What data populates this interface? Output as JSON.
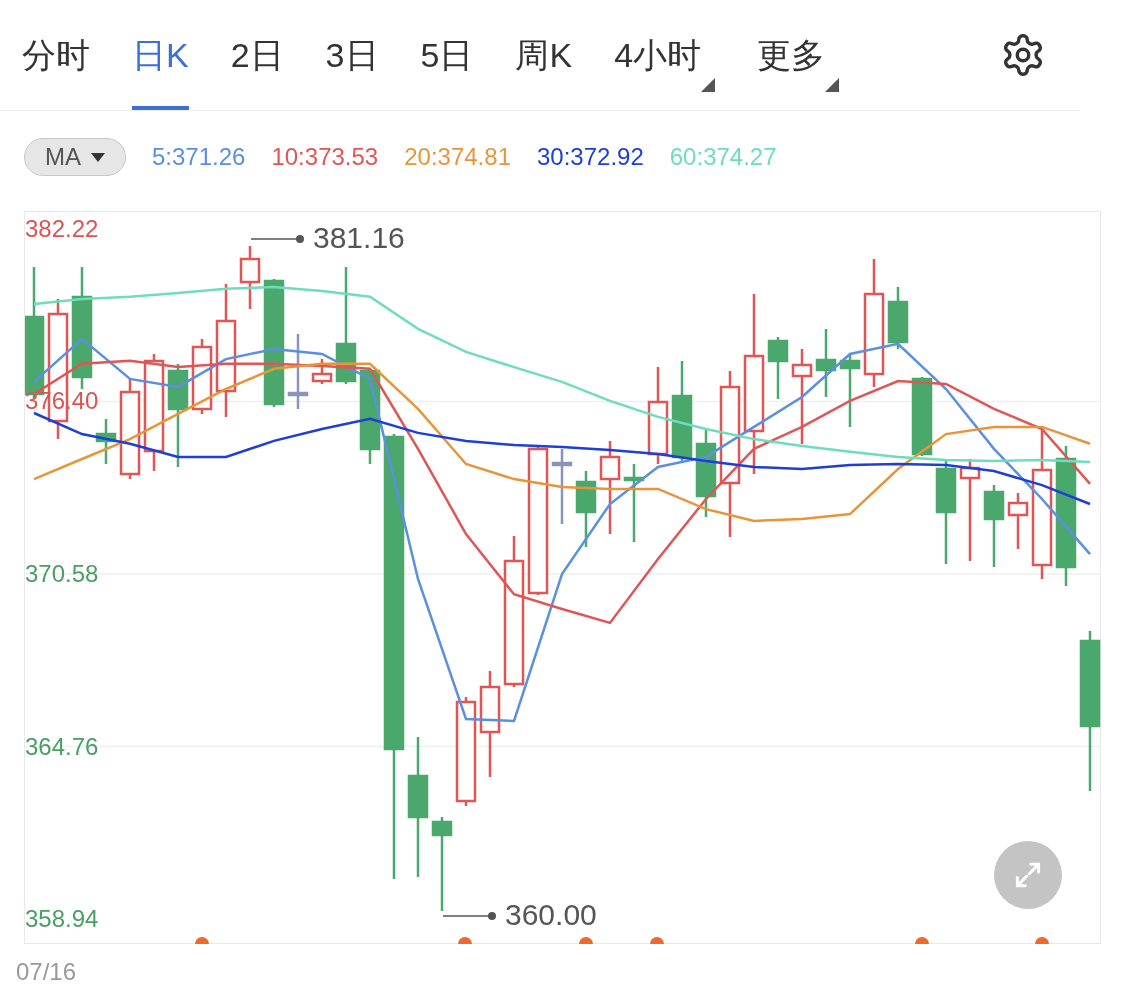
{
  "tabs": [
    {
      "label": "分时",
      "selected": false,
      "kind": "plain"
    },
    {
      "label": "日K",
      "selected": true,
      "kind": "plain"
    },
    {
      "label": "2日",
      "selected": false,
      "kind": "plain"
    },
    {
      "label": "3日",
      "selected": false,
      "kind": "plain"
    },
    {
      "label": "5日",
      "selected": false,
      "kind": "plain"
    },
    {
      "label": "周K",
      "selected": false,
      "kind": "plain"
    },
    {
      "label": "4小时",
      "selected": false,
      "kind": "menu"
    },
    {
      "label": "更多",
      "selected": false,
      "kind": "menu"
    }
  ],
  "indicator": {
    "selector": "MA"
  },
  "chart": {
    "chart_data": {
      "type": "line",
      "grid": true,
      "ylim": [
        358.1,
        382.79
      ],
      "yticks": [
        {
          "value": 382.22,
          "label": "382.22"
        },
        {
          "value": 376.4,
          "label": "376.40"
        },
        {
          "value": 370.58,
          "label": "370.58"
        },
        {
          "value": 364.76,
          "label": "364.76"
        },
        {
          "value": 358.94,
          "label": "358.94"
        }
      ],
      "series": [
        {
          "name": "5:371.26",
          "color": "#5b8fe0",
          "values": [
            377.06,
            378.51,
            377.16,
            376.89,
            377.83,
            378.17,
            378.0,
            377.16,
            370.41,
            365.69,
            365.62,
            370.58,
            372.94,
            374.19,
            374.53,
            375.54,
            376.55,
            378.0,
            378.34,
            376.82,
            374.8,
            373.11,
            371.25
          ]
        },
        {
          "name": "10:373.53",
          "color": "#e05555",
          "values": [
            376.65,
            377.67,
            377.77,
            377.56,
            377.67,
            377.67,
            377.6,
            377.5,
            374.8,
            371.93,
            369.9,
            369.4,
            368.93,
            371.09,
            373.11,
            374.8,
            375.54,
            376.42,
            377.09,
            376.99,
            376.15,
            375.47,
            373.62
          ]
        },
        {
          "name": "20:374.81",
          "color": "#e8953a",
          "values": [
            373.78,
            374.46,
            375.13,
            375.98,
            376.82,
            377.5,
            377.67,
            377.67,
            376.15,
            374.29,
            373.78,
            373.51,
            373.45,
            373.45,
            372.77,
            372.37,
            372.44,
            372.6,
            374.12,
            375.3,
            375.54,
            375.54,
            374.97
          ]
        },
        {
          "name": "30:372.92",
          "color": "#1d3fd6",
          "values": [
            376.01,
            375.3,
            374.97,
            374.53,
            374.53,
            375.07,
            375.47,
            375.81,
            375.34,
            375.07,
            374.93,
            374.86,
            374.76,
            374.63,
            374.39,
            374.19,
            374.12,
            374.26,
            374.29,
            374.26,
            374.05,
            373.58,
            372.94
          ]
        },
        {
          "name": "60:374.27",
          "color": "#6fdcbd",
          "values": [
            379.69,
            379.86,
            379.93,
            380.06,
            380.2,
            380.26,
            380.13,
            379.93,
            378.85,
            378.07,
            377.56,
            377.06,
            376.42,
            375.88,
            375.47,
            375.13,
            374.9,
            374.7,
            374.53,
            374.43,
            374.39,
            374.43,
            374.36
          ]
        }
      ]
    },
    "axis_labels": [
      {
        "color": "#d95454"
      },
      {
        "color": "#d95454"
      },
      {
        "color": "#4a9e64"
      },
      {
        "color": "#4a9e64"
      },
      {
        "color": "#4a9e64"
      }
    ],
    "max_label": "381.16",
    "min_label": "360.00",
    "date_label": "07/16"
  }
}
